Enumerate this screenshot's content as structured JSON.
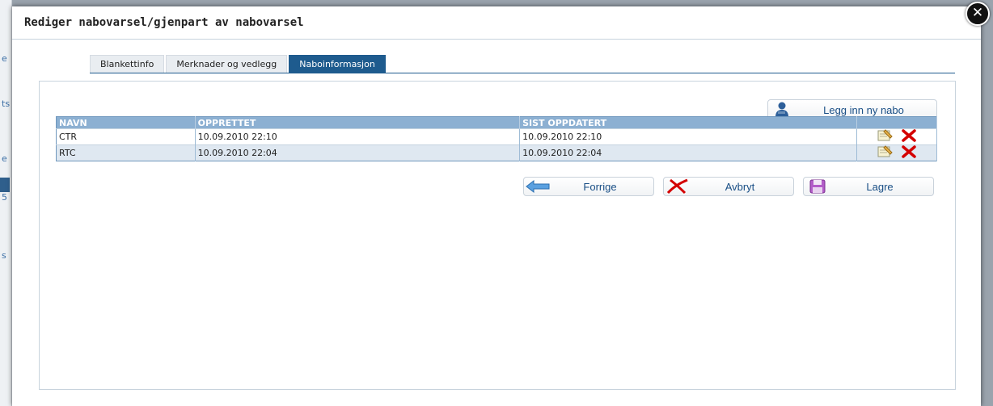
{
  "dialog": {
    "title": "Rediger nabovarsel/gjenpart av nabovarsel",
    "close_glyph": "✕"
  },
  "background": {
    "fragments": [
      "e",
      "ts",
      "e",
      "5",
      "s"
    ]
  },
  "tabs": [
    {
      "label": "Blankettinfo",
      "active": false
    },
    {
      "label": "Merknader og vedlegg",
      "active": false
    },
    {
      "label": "Naboinformasjon",
      "active": true
    }
  ],
  "toolbar": {
    "add_neighbor_label": "Legg inn ny nabo",
    "add_neighbor_icon": "person-add-icon"
  },
  "table": {
    "headers": [
      "NAVN",
      "OPPRETTET",
      "SIST OPPDATERT",
      ""
    ],
    "rows": [
      {
        "navn": "CTR",
        "opprettet": "10.09.2010 22:10",
        "sist_oppdatert": "10.09.2010 22:10"
      },
      {
        "navn": "RTC",
        "opprettet": "10.09.2010 22:04",
        "sist_oppdatert": "10.09.2010 22:04"
      }
    ]
  },
  "actions": {
    "back_label": "Forrige",
    "cancel_label": "Avbryt",
    "save_label": "Lagre"
  },
  "colors": {
    "accent": "#1e5b8e",
    "table_header": "#8cb0d2",
    "alt_row": "#dfe8f1",
    "delete_red": "#d40000",
    "link_text": "#1a4f86"
  }
}
